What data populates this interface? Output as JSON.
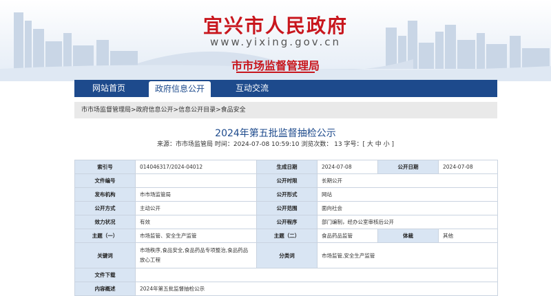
{
  "header": {
    "site_title": "宜兴市人民政府",
    "site_url": "www.yixing.gov.cn",
    "department": "市市场监督管理局"
  },
  "nav": {
    "items": [
      {
        "label": "网站首页"
      },
      {
        "label": "政府信息公开"
      },
      {
        "label": "互动交流"
      }
    ],
    "active_index": 1
  },
  "breadcrumb": "市市场监督管理局>政府信息公开>信息公开目录>食品安全",
  "article": {
    "title": "2024年第五批监督抽检公示",
    "meta": "来源：市市场监管局 时间：2024-07-08 10:59:10 浏览次数： 13 字号：[ 大 中 小 ]"
  },
  "info": {
    "index_no_label": "索引号",
    "index_no": "014046317/2024-04012",
    "gen_date_label": "生成日期",
    "gen_date": "2024-07-08",
    "pub_date_label": "公开日期",
    "pub_date": "2024-07-08",
    "doc_no_label": "文件编号",
    "doc_no": "",
    "pub_period_label": "公开时限",
    "pub_period": "长期公开",
    "issuer_label": "发布机构",
    "issuer": "市市场监管局",
    "pub_form_label": "公开形式",
    "pub_form": "网站",
    "pub_mode_label": "公开方式",
    "pub_mode": "主动公开",
    "pub_scope_label": "公开范围",
    "pub_scope": "面向社会",
    "validity_label": "效力状况",
    "validity": "有效",
    "procedure_label": "公开程序",
    "procedure": "部门编制，经办公室审核后公开",
    "topic1_label": "主题（一）",
    "topic1": "市场监管、安全生产监管",
    "topic2_label": "主题（二）",
    "topic2": "食品药品监管",
    "genre_label": "体裁",
    "genre": "其他",
    "keywords_label": "关键词",
    "keywords": "市场秩序,食品安全,食品药品专项整治,食品药品放心工程",
    "category_label": "分类词",
    "category": "市场监管,安全生产监管",
    "download_label": "文件下载",
    "download": "",
    "summary_label": "内容概述",
    "summary": "2024年第五批监督抽检公示"
  },
  "colors": {
    "brand_red": "#c8161d",
    "nav_blue": "#1d4a8c",
    "label_bg": "#d9e5f3"
  }
}
